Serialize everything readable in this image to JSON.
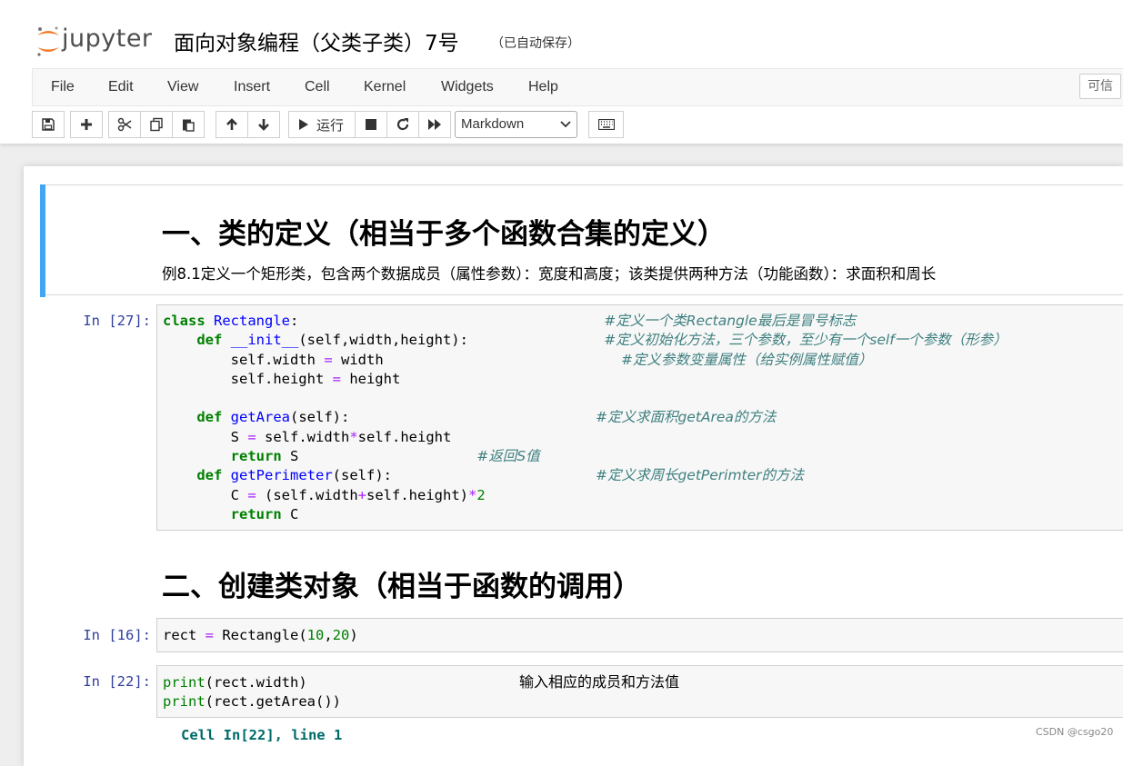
{
  "header": {
    "logo_text": "jupyter",
    "notebook_title": "面向对象编程（父类子类）7号",
    "save_status": "（已自动保存）",
    "trusted_label": "可信"
  },
  "menu": [
    "File",
    "Edit",
    "View",
    "Insert",
    "Cell",
    "Kernel",
    "Widgets",
    "Help"
  ],
  "toolbar": {
    "run_label": "运行",
    "cell_type": "Markdown",
    "icons": [
      "save-icon",
      "plus-icon",
      "scissors-icon",
      "copy-icon",
      "paste-icon",
      "arrow-up-icon",
      "arrow-down-icon",
      "play-icon",
      "stop-icon",
      "restart-icon",
      "fast-forward-icon",
      "keyboard-icon"
    ]
  },
  "cells": {
    "md1": {
      "heading": "一、类的定义（相当于多个函数合集的定义）",
      "text": "例8.1定义一个矩形类，包含两个数据成员（属性参数）：宽度和高度；该类提供两种方法（功能函数）：求面积和周长"
    },
    "code1": {
      "prompt": "In  [27]:",
      "comments": [
        "#定义一个类Rectangle最后是冒号标志",
        "#定义初始化方法，三个参数，至少有一个self一个参数（形参）",
        "#定义参数变量属性（给实例属性赋值）",
        "#定义求面积getArea的方法",
        "#返回S值",
        "#定义求周长getPerimter的方法"
      ]
    },
    "md2": {
      "heading": "二、创建类对象（相当于函数的调用）"
    },
    "code2": {
      "prompt": "In  [16]:"
    },
    "code3": {
      "prompt": "In  [22]:",
      "note": "输入相应的成员和方法值",
      "output_line": "Cell In[22], line 1"
    }
  },
  "watermark": "CSDN @csgo20",
  "colors": {
    "selected_bar": "#42a5f5",
    "prompt": "#303f9f",
    "keyword": "#008000",
    "function_name": "#0000ff",
    "operator": "#aa22ff",
    "comment": "#408080"
  }
}
